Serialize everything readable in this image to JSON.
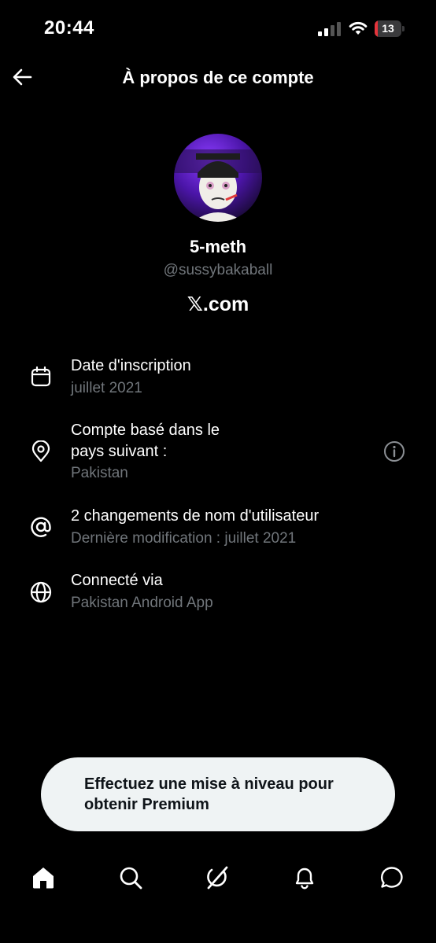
{
  "status_bar": {
    "time": "20:44",
    "battery_level": "13",
    "battery_color": "#e5343b"
  },
  "header": {
    "title": "À propos de ce compte",
    "back_icon": "arrow-left-icon"
  },
  "profile": {
    "display_name": "5-meth",
    "handle": "@sussybakaball",
    "site": "𝕏.com"
  },
  "details": [
    {
      "icon": "calendar-icon",
      "title": "Date d'inscription",
      "subtitle": "juillet 2021"
    },
    {
      "icon": "location-pin-icon",
      "title_line1": "Compte basé dans le",
      "title_line2": "pays suivant :",
      "subtitle": "Pakistan",
      "info_icon": "info-icon"
    },
    {
      "icon": "at-sign-icon",
      "title": "2 changements de nom d'utilisateur",
      "subtitle": "Dernière modification : juillet 2021"
    },
    {
      "icon": "globe-icon",
      "title": "Connecté via",
      "subtitle": "Pakistan Android App"
    }
  ],
  "premium_banner": {
    "line1": "Effectuez une mise à niveau pour",
    "line2": "obtenir Premium"
  },
  "tab_bar": [
    "home-icon",
    "search-icon",
    "grok-icon",
    "bell-icon",
    "messages-icon"
  ],
  "colors": {
    "background": "#000000",
    "text": "#ffffff",
    "muted": "#71767b",
    "pill": "#eff3f4"
  }
}
